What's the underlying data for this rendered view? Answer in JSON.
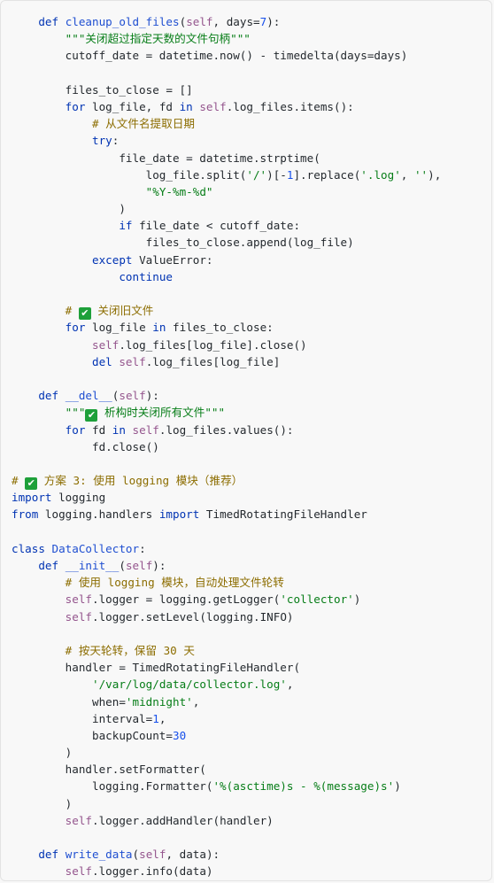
{
  "code_block": {
    "lines": [
      [
        {
          "t": "    "
        },
        {
          "c": "kw",
          "t": "def"
        },
        {
          "t": " "
        },
        {
          "c": "fn",
          "t": "cleanup_old_files"
        },
        {
          "t": "("
        },
        {
          "c": "sf",
          "t": "self"
        },
        {
          "t": ", days="
        },
        {
          "c": "nm",
          "t": "7"
        },
        {
          "t": "):"
        }
      ],
      [
        {
          "t": "        "
        },
        {
          "c": "st",
          "t": "\"\"\"关闭超过指定天数的文件句柄\"\"\""
        }
      ],
      [
        {
          "t": "        cutoff_date = datetime.now() - timedelta(days=days)"
        }
      ],
      [
        {
          "t": ""
        }
      ],
      [
        {
          "t": "        files_to_close = []"
        }
      ],
      [
        {
          "t": "        "
        },
        {
          "c": "kw",
          "t": "for"
        },
        {
          "t": " log_file, fd "
        },
        {
          "c": "kw",
          "t": "in"
        },
        {
          "t": " "
        },
        {
          "c": "sf",
          "t": "self"
        },
        {
          "t": ".log_files.items():"
        }
      ],
      [
        {
          "t": "            "
        },
        {
          "c": "cm",
          "t": "# 从文件名提取日期"
        }
      ],
      [
        {
          "t": "            "
        },
        {
          "c": "kw",
          "t": "try"
        },
        {
          "t": ":"
        }
      ],
      [
        {
          "t": "                file_date = datetime.strptime("
        }
      ],
      [
        {
          "t": "                    log_file.split("
        },
        {
          "c": "st",
          "t": "'/'"
        },
        {
          "t": ")[-"
        },
        {
          "c": "nm",
          "t": "1"
        },
        {
          "t": "].replace("
        },
        {
          "c": "st",
          "t": "'.log'"
        },
        {
          "t": ", "
        },
        {
          "c": "st",
          "t": "''"
        },
        {
          "t": "),"
        }
      ],
      [
        {
          "t": "                    "
        },
        {
          "c": "st",
          "t": "\"%Y-%m-%d\""
        }
      ],
      [
        {
          "t": "                )"
        }
      ],
      [
        {
          "t": "                "
        },
        {
          "c": "kw",
          "t": "if"
        },
        {
          "t": " file_date < cutoff_date:"
        }
      ],
      [
        {
          "t": "                    files_to_close.append(log_file)"
        }
      ],
      [
        {
          "t": "            "
        },
        {
          "c": "kw",
          "t": "except"
        },
        {
          "t": " ValueError:"
        }
      ],
      [
        {
          "t": "                "
        },
        {
          "c": "kw",
          "t": "continue"
        }
      ],
      [
        {
          "t": ""
        }
      ],
      [
        {
          "t": "        "
        },
        {
          "c": "cm",
          "t": "# "
        },
        {
          "c": "em",
          "t": "✔"
        },
        {
          "c": "cm",
          "t": " 关闭旧文件"
        }
      ],
      [
        {
          "t": "        "
        },
        {
          "c": "kw",
          "t": "for"
        },
        {
          "t": " log_file "
        },
        {
          "c": "kw",
          "t": "in"
        },
        {
          "t": " files_to_close:"
        }
      ],
      [
        {
          "t": "            "
        },
        {
          "c": "sf",
          "t": "self"
        },
        {
          "t": ".log_files[log_file].close()"
        }
      ],
      [
        {
          "t": "            "
        },
        {
          "c": "kw",
          "t": "del"
        },
        {
          "t": " "
        },
        {
          "c": "sf",
          "t": "self"
        },
        {
          "t": ".log_files[log_file]"
        }
      ],
      [
        {
          "t": ""
        }
      ],
      [
        {
          "t": "    "
        },
        {
          "c": "kw",
          "t": "def"
        },
        {
          "t": " "
        },
        {
          "c": "fn",
          "t": "__del__"
        },
        {
          "t": "("
        },
        {
          "c": "sf",
          "t": "self"
        },
        {
          "t": "):"
        }
      ],
      [
        {
          "t": "        "
        },
        {
          "c": "st",
          "t": "\"\"\""
        },
        {
          "c": "em",
          "t": "✔"
        },
        {
          "c": "st",
          "t": " 析构时关闭所有文件\"\"\""
        }
      ],
      [
        {
          "t": "        "
        },
        {
          "c": "kw",
          "t": "for"
        },
        {
          "t": " fd "
        },
        {
          "c": "kw",
          "t": "in"
        },
        {
          "t": " "
        },
        {
          "c": "sf",
          "t": "self"
        },
        {
          "t": ".log_files.values():"
        }
      ],
      [
        {
          "t": "            fd.close()"
        }
      ],
      [
        {
          "t": ""
        }
      ],
      [
        {
          "c": "cm",
          "t": "# "
        },
        {
          "c": "em",
          "t": "✔"
        },
        {
          "c": "cm",
          "t": " 方案 3: 使用 logging 模块（推荐）"
        }
      ],
      [
        {
          "c": "kw",
          "t": "import"
        },
        {
          "t": " logging"
        }
      ],
      [
        {
          "c": "kw",
          "t": "from"
        },
        {
          "t": " logging.handlers "
        },
        {
          "c": "kw",
          "t": "import"
        },
        {
          "t": " TimedRotatingFileHandler"
        }
      ],
      [
        {
          "t": ""
        }
      ],
      [
        {
          "c": "kw",
          "t": "class"
        },
        {
          "t": " "
        },
        {
          "c": "cl",
          "t": "DataCollector"
        },
        {
          "t": ":"
        }
      ],
      [
        {
          "t": "    "
        },
        {
          "c": "kw",
          "t": "def"
        },
        {
          "t": " "
        },
        {
          "c": "fn",
          "t": "__init__"
        },
        {
          "t": "("
        },
        {
          "c": "sf",
          "t": "self"
        },
        {
          "t": "):"
        }
      ],
      [
        {
          "t": "        "
        },
        {
          "c": "cm",
          "t": "# 使用 logging 模块，自动处理文件轮转"
        }
      ],
      [
        {
          "t": "        "
        },
        {
          "c": "sf",
          "t": "self"
        },
        {
          "t": ".logger = logging.getLogger("
        },
        {
          "c": "st",
          "t": "'collector'"
        },
        {
          "t": ")"
        }
      ],
      [
        {
          "t": "        "
        },
        {
          "c": "sf",
          "t": "self"
        },
        {
          "t": ".logger.setLevel(logging.INFO)"
        }
      ],
      [
        {
          "t": ""
        }
      ],
      [
        {
          "t": "        "
        },
        {
          "c": "cm",
          "t": "# 按天轮转，保留 30 天"
        }
      ],
      [
        {
          "t": "        handler = TimedRotatingFileHandler("
        }
      ],
      [
        {
          "t": "            "
        },
        {
          "c": "st",
          "t": "'/var/log/data/collector.log'"
        },
        {
          "t": ","
        }
      ],
      [
        {
          "t": "            when="
        },
        {
          "c": "st",
          "t": "'midnight'"
        },
        {
          "t": ","
        }
      ],
      [
        {
          "t": "            interval="
        },
        {
          "c": "nm",
          "t": "1"
        },
        {
          "t": ","
        }
      ],
      [
        {
          "t": "            backupCount="
        },
        {
          "c": "nm",
          "t": "30"
        }
      ],
      [
        {
          "t": "        )"
        }
      ],
      [
        {
          "t": "        handler.setFormatter("
        }
      ],
      [
        {
          "t": "            logging.Formatter("
        },
        {
          "c": "st",
          "t": "'%(asctime)s - %(message)s'"
        },
        {
          "t": ")"
        }
      ],
      [
        {
          "t": "        )"
        }
      ],
      [
        {
          "t": "        "
        },
        {
          "c": "sf",
          "t": "self"
        },
        {
          "t": ".logger.addHandler(handler)"
        }
      ],
      [
        {
          "t": ""
        }
      ],
      [
        {
          "t": "    "
        },
        {
          "c": "kw",
          "t": "def"
        },
        {
          "t": " "
        },
        {
          "c": "fn",
          "t": "write_data"
        },
        {
          "t": "("
        },
        {
          "c": "sf",
          "t": "self"
        },
        {
          "t": ", data):"
        }
      ],
      [
        {
          "t": "        "
        },
        {
          "c": "sf",
          "t": "self"
        },
        {
          "t": ".logger.info(data)"
        }
      ]
    ]
  }
}
